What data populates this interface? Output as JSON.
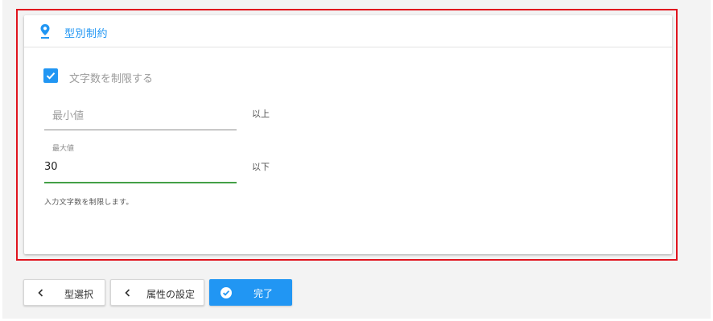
{
  "section": {
    "title": "型別制約",
    "icon": "map-pin-icon"
  },
  "checkbox": {
    "label": "文字数を制限する",
    "checked": true
  },
  "min_field": {
    "placeholder": "最小値",
    "value": "",
    "suffix": "以上"
  },
  "max_field": {
    "label": "最大値",
    "value": "30",
    "suffix": "以下"
  },
  "helper_text": "入力文字数を制限します。",
  "buttons": {
    "back_type": "型選択",
    "back_attr": "属性の設定",
    "done": "完了"
  },
  "colors": {
    "accent": "#2196f3",
    "focus_underline": "#43a047",
    "highlight_border": "#e0141e"
  }
}
